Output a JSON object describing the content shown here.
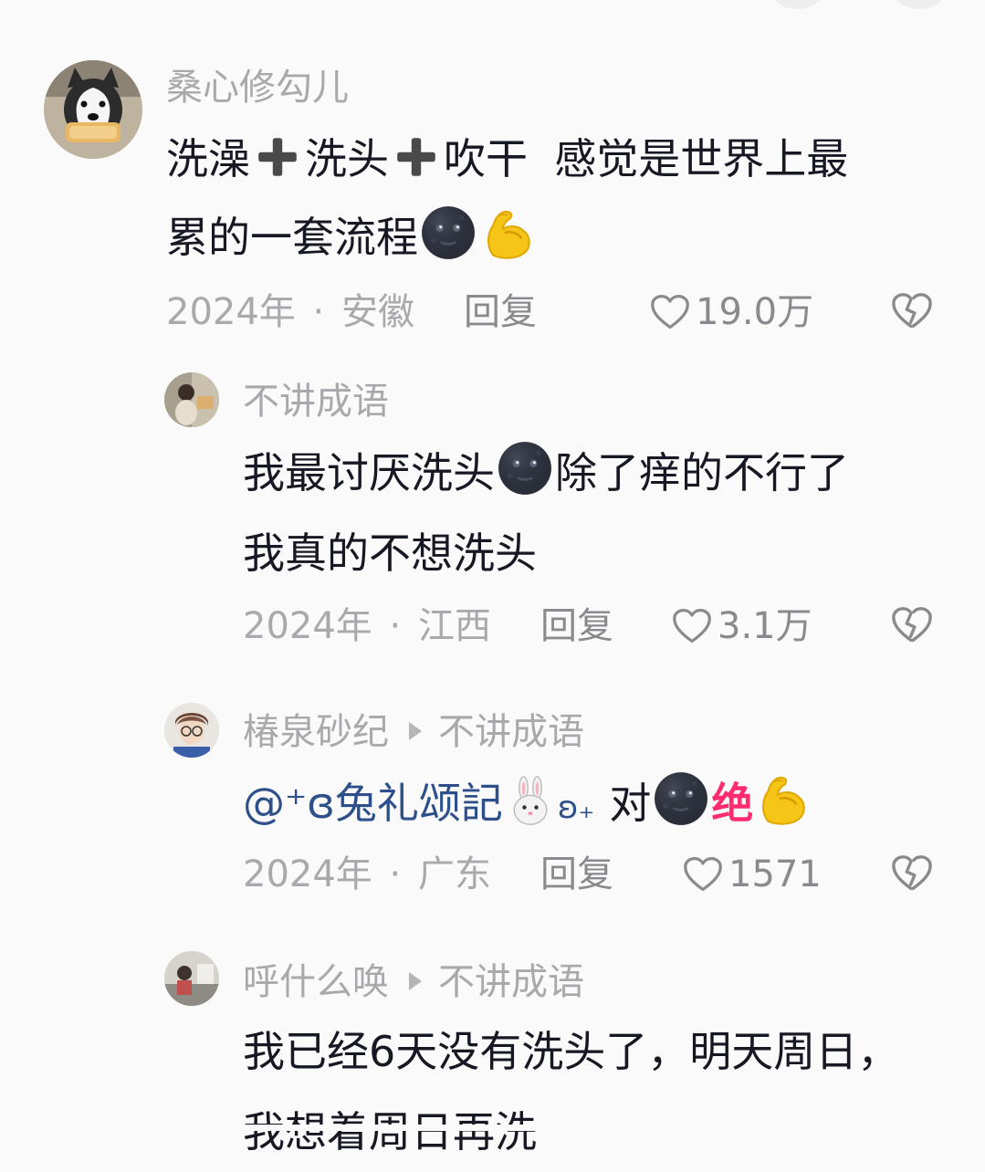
{
  "comments": [
    {
      "author": "桑心修勾儿",
      "text_parts": [
        "洗澡",
        "洗头",
        "吹干  感觉是世界上最"
      ],
      "line2": "累的一套流程",
      "year": "2024年",
      "separator": "·",
      "location": "安徽",
      "reply": "回复",
      "likes": "19.0万"
    },
    {
      "author": "不讲成语",
      "line1": "我最讨厌洗头",
      "line1b": "除了痒的不行了",
      "line2": "我真的不想洗头",
      "year": "2024年",
      "separator": "·",
      "location": "江西",
      "reply": "回复",
      "likes": "3.1万"
    },
    {
      "author": "椿泉砂纪",
      "reply_to": "不讲成语",
      "mention": "@⁺ɞ兔礼颂記",
      "mention_suffix": "ʚ₊",
      "text_a": "对",
      "text_b": "绝",
      "year": "2024年",
      "separator": "·",
      "location": "广东",
      "reply": "回复",
      "likes": "1571"
    },
    {
      "author": "呼什么唤",
      "reply_to": "不讲成语",
      "line1": "我已经6天没有洗头了，明天周日，",
      "line2": "我想着周日再洗"
    }
  ],
  "colors": {
    "text": "#161823",
    "meta": "#a9a9ad",
    "mention": "#2d4f8a",
    "highlight": "#ff2d6f"
  },
  "icons": [
    "heart-icon",
    "dislike-heart-icon",
    "plus-emoji-icon",
    "moon-emoji-icon",
    "muscle-emoji-icon",
    "rabbit-emoji-icon"
  ]
}
